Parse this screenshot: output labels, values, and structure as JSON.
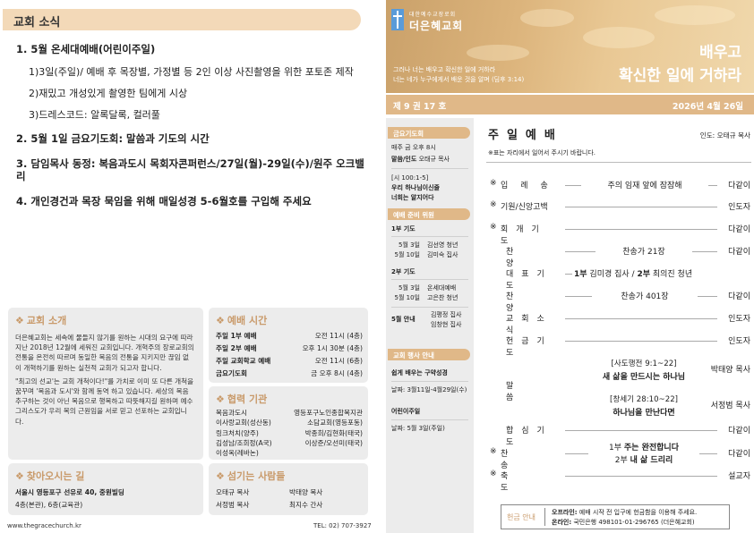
{
  "left": {
    "news_title": "교회 소식",
    "news": {
      "item1": "1. 5월 온세대예배(어린이주일)",
      "item1_sub1": "1)3일(주일)/ 예배 후 목장별, 가정별 등 2인 이상 사진촬영을 위한 포토존 제작",
      "item1_sub2": "2)재밌고 개성있게 촬영한 팀에게 시상",
      "item1_sub3": "3)드레스코드: 알록달록, 컬러풀",
      "item2": "2. 5월 1일 금요기도회: 말씀과 기도의 시간",
      "item3": "3. 담임목사 동정: 복음과도시 목회자콘퍼런스/27일(월)-29일(수)/원주 오크밸리",
      "item4": "4. 개인경건과 목장 묵임을 위해 매일성경 5-6월호를 구입해 주세요"
    },
    "intro": {
      "title": "교회 소개",
      "p1": "더은혜교회는 세속에 물들지 않기를 원하는 시대의 요구에 따라 지난 2018년 12월에 세워진 교회입니다. 개혁주의 장로교회의 전통을 온전히 따르며 동일한 복음의 전통을 지키지만 끊임 없이 개혁하기를 원하는 실천적 교회가 되고자 합니다.",
      "p2": "\"최고의 선교'는 교회 개척이다!\"를 가치로 이미 또 다른 개척을 꿈꾸며 '복음과 도시'와 함께 동역 하고 있습니다. 세상의 복음 추구하는 것이 아닌 복음으로 행복하고 따뜻해지길 원하며 예수 그리스도가 우리 복의 근원임을 서로 믿고 선포하는 교회입니다."
    },
    "services": {
      "title": "예배 시간",
      "rows": [
        {
          "k": "주일 1부 예배",
          "v": "오전 11시 (4층)"
        },
        {
          "k": "주일 2부 예배",
          "v": "오후 1시 30분 (4층)"
        },
        {
          "k": "주일 교회학교 예배",
          "v": "오전 11시 (6층)"
        },
        {
          "k": "금요기도회",
          "v": "금 오후 8시 (4층)"
        }
      ]
    },
    "coop": {
      "title": "협력 기관",
      "rows": [
        {
          "a": "복음과도시",
          "b": "영등포구노인종합복지관"
        },
        {
          "a": "이사랑교회(성산동)",
          "b": "소담교회(영등포동)"
        },
        {
          "a": "링크처치(양주)",
          "b": "박종희/김현화(태국)"
        },
        {
          "a": "김성남/조희정(A국)",
          "b": "이상준/오선미(태국)"
        },
        {
          "a": "이성옥(레바논)",
          "b": ""
        }
      ]
    },
    "location": {
      "title": "찾아오시는 길",
      "addr": "서울시 영등포구 선유로 40, 중원빌딩",
      "floor": "4층(본관), 6층(교육관)"
    },
    "servers": {
      "title": "섬기는 사람들",
      "r1a": "오태규 목사",
      "r1b": "박태양 목사",
      "r2a": "서정범 목사",
      "r2b": "최지수 간사"
    },
    "footer_url": "www.thegracechurch.kr",
    "footer_tel": "TEL: 02) 707-3927"
  },
  "right": {
    "logo_small": "대한예수교장로회",
    "logo_name": "더은혜교회",
    "hero_title1": "배우고",
    "hero_title2": "확신한 일에 거하라",
    "hero_verse1": "그러나 너는 배우고 확신한 일에 거하라",
    "hero_verse2": "너는 네가 누구에게서 배운 것을 알며 (딤후 3:14)",
    "vol": "제 9 권  17 호",
    "date": "2026년 4월 26일",
    "side": {
      "fri_tag": "금요기도회",
      "fri_time": "매주 금 오후 8시",
      "fri_lead_k": "말씀/인도",
      "fri_lead_v": "오태규 목사",
      "fri_verse": "[시 100:1-5]",
      "fri_theme1": "우리 하나님이신줄",
      "fri_theme2": "너희는 알지어다",
      "prep_tag": "예배 준비 위원",
      "p1_head": "1부 기도",
      "p1_r1_d": "5월  3일",
      "p1_r1_n": "김선영 청년",
      "p1_r2_d": "5월 10일",
      "p1_r2_n": "김미숙 집사",
      "p2_head": "2부 기도",
      "p2_r1_d": "5월  3일",
      "p2_r1_n": "온세대예배",
      "p2_r2_d": "5월 10일",
      "p2_r2_n": "고은찬 청년",
      "guide_head": "5월 안내",
      "guide_n1": "김평정 집사",
      "guide_n2": "임창현 집사",
      "event_tag": "교회 행사 안내",
      "ev1_title": "쉽게 배우는 구약성경",
      "ev1_date": "날짜: 3월11일-4월29일(수)",
      "ev2_title": "어린이주일",
      "ev2_date": "날짜: 5월 3일(주일)"
    },
    "worship": {
      "title": "주일예배",
      "lead": "인도: 오태규 목사",
      "note": "※표는 자리에서 일어서 주시기 바랍니다.",
      "order": [
        {
          "star": "※",
          "label": "입례송",
          "center": "주의 임재 앞에 잠잠해",
          "person": "다같이"
        },
        {
          "star": "※",
          "label": "기원/신앙고백",
          "center": "",
          "person": "인도자"
        },
        {
          "star": "※",
          "label": "회개기도",
          "center": "",
          "person": "다같이"
        },
        {
          "star": "",
          "label": "찬양",
          "center": "찬송가 21장",
          "person": "다같이"
        },
        {
          "star": "",
          "label": "대표기도",
          "center_b1": "1부",
          "center_t1": " 김미경 집사 / ",
          "center_b2": "2부",
          "center_t2": " 최의진 청년",
          "person": ""
        },
        {
          "star": "",
          "label": "찬양",
          "center": "찬송가 401장",
          "person": "다같이"
        },
        {
          "star": "",
          "label": "교회소식",
          "center": "",
          "person": "인도자"
        },
        {
          "star": "",
          "label": "헌금기도",
          "center": "",
          "person": "인도자"
        },
        {
          "star": "",
          "label": "말씀",
          "center": "",
          "person": ""
        },
        {
          "star": "",
          "label": "합심기도",
          "center": "",
          "person": "다같이"
        },
        {
          "star": "※",
          "label": "찬송",
          "center": "",
          "person": "다같이"
        },
        {
          "star": "※",
          "label": "축도",
          "center": "",
          "person": "설교자"
        }
      ],
      "sermon1_ref": "[사도행전 9:1~22]",
      "sermon1_title": "새 삶을 만드시는 하나님",
      "sermon1_person": "박태양 목사",
      "sermon2_ref": "[창세기 28:10~22]",
      "sermon2_title": "하나님을 만난다면",
      "sermon2_person": "서정범 목사",
      "hymn_line1_a": "1부 ",
      "hymn_line1_b": "주는 완전합니다",
      "hymn_line2_a": "2부 ",
      "hymn_line2_b": "내 삶 드리리"
    },
    "offering": {
      "label": "헌금 안내",
      "online_k": "오프라인:",
      "online_v": " 예배 시작 전 입구에 헌금함을 이용해 주세요.",
      "bank_k": "온라인:",
      "bank_v": " 국민은행 498101-01-296765 (더은혜교회)"
    }
  }
}
